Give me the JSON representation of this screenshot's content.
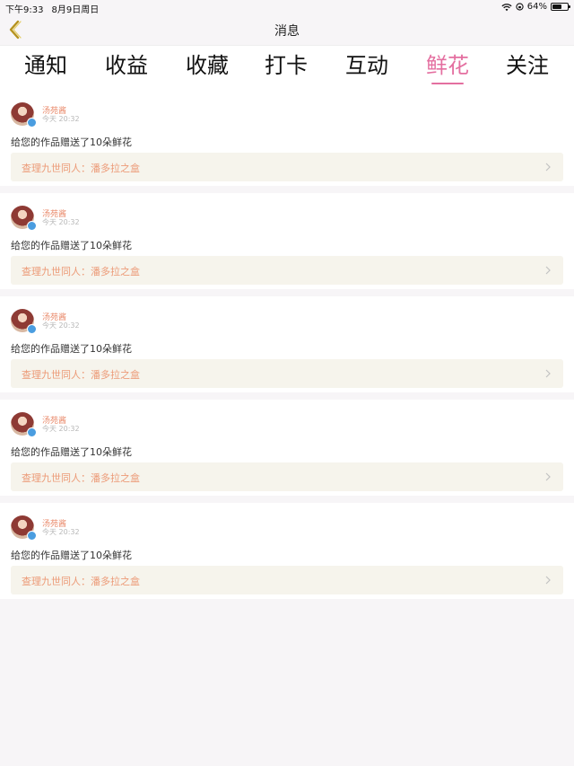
{
  "status_bar": {
    "time": "下午9:33",
    "date": "8月9日周日",
    "battery": "64%",
    "battery_level": 0.64
  },
  "nav": {
    "title": "消息",
    "back_icon": "chevron-left-icon"
  },
  "tabs": [
    {
      "label": "通知"
    },
    {
      "label": "收益"
    },
    {
      "label": "收藏"
    },
    {
      "label": "打卡"
    },
    {
      "label": "互动"
    },
    {
      "label": "鲜花",
      "active": true
    },
    {
      "label": "关注"
    }
  ],
  "colors": {
    "active_tab": "#e46fa0",
    "username": "#e9896a",
    "link_text": "#ec9a77",
    "link_bg": "#f6f4ec",
    "verified_badge": "#4a9de0"
  },
  "messages": [
    {
      "username": "汤苑酱",
      "time": "今天 20:32",
      "message": "给您的作品赠送了10朵鲜花",
      "work": "查理九世同人：潘多拉之盒"
    },
    {
      "username": "汤苑酱",
      "time": "今天 20:32",
      "message": "给您的作品赠送了10朵鲜花",
      "work": "查理九世同人：潘多拉之盒"
    },
    {
      "username": "汤苑酱",
      "time": "今天 20:32",
      "message": "给您的作品赠送了10朵鲜花",
      "work": "查理九世同人：潘多拉之盒"
    },
    {
      "username": "汤苑酱",
      "time": "今天 20:32",
      "message": "给您的作品赠送了10朵鲜花",
      "work": "查理九世同人：潘多拉之盒"
    },
    {
      "username": "汤苑酱",
      "time": "今天 20:32",
      "message": "给您的作品赠送了10朵鲜花",
      "work": "查理九世同人：潘多拉之盒"
    }
  ]
}
